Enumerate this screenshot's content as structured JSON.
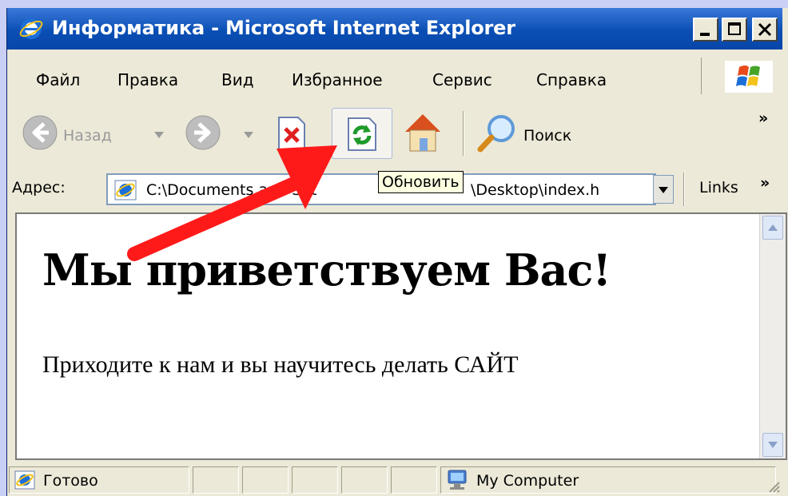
{
  "window": {
    "title": "Информатика - Microsoft Internet Explorer",
    "controls": {
      "minimize": "_",
      "maximize": "□",
      "close": "×"
    }
  },
  "menu": {
    "items": [
      "Файл",
      "Правка",
      "Вид",
      "Избранное",
      "Сервис",
      "Справка"
    ]
  },
  "toolbar": {
    "back_label": "Назад",
    "search_label": "Поиск",
    "chevron": "»"
  },
  "address": {
    "label": "Адрес:",
    "value": "C:\\Documents and Settings\\User\\Desktop\\index.htm",
    "shown_left": "C:\\Documents and Set",
    "shown_right": "\\Desktop\\index.h",
    "links_label": "Links",
    "chevron": "»"
  },
  "tooltip": {
    "text": "Обновить"
  },
  "page": {
    "heading": "Мы приветствуем Вас!",
    "paragraph": "Приходите к нам и вы научитесь делать САЙТ"
  },
  "status": {
    "left": "Готово",
    "zone": "My Computer"
  },
  "annotation": {
    "arrow_color": "#ff1a1a"
  }
}
